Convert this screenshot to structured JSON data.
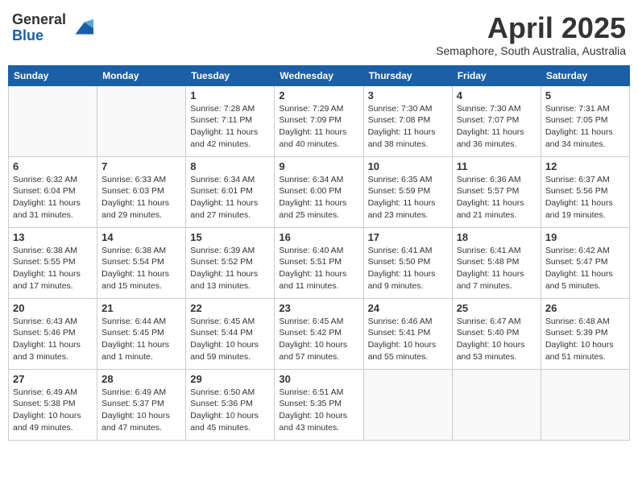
{
  "header": {
    "logo": {
      "general": "General",
      "blue": "Blue"
    },
    "title": "April 2025",
    "subtitle": "Semaphore, South Australia, Australia"
  },
  "calendar": {
    "days_of_week": [
      "Sunday",
      "Monday",
      "Tuesday",
      "Wednesday",
      "Thursday",
      "Friday",
      "Saturday"
    ],
    "weeks": [
      [
        {
          "day": "",
          "info": ""
        },
        {
          "day": "",
          "info": ""
        },
        {
          "day": "1",
          "info": "Sunrise: 7:28 AM\nSunset: 7:11 PM\nDaylight: 11 hours\nand 42 minutes."
        },
        {
          "day": "2",
          "info": "Sunrise: 7:29 AM\nSunset: 7:09 PM\nDaylight: 11 hours\nand 40 minutes."
        },
        {
          "day": "3",
          "info": "Sunrise: 7:30 AM\nSunset: 7:08 PM\nDaylight: 11 hours\nand 38 minutes."
        },
        {
          "day": "4",
          "info": "Sunrise: 7:30 AM\nSunset: 7:07 PM\nDaylight: 11 hours\nand 36 minutes."
        },
        {
          "day": "5",
          "info": "Sunrise: 7:31 AM\nSunset: 7:05 PM\nDaylight: 11 hours\nand 34 minutes."
        }
      ],
      [
        {
          "day": "6",
          "info": "Sunrise: 6:32 AM\nSunset: 6:04 PM\nDaylight: 11 hours\nand 31 minutes."
        },
        {
          "day": "7",
          "info": "Sunrise: 6:33 AM\nSunset: 6:03 PM\nDaylight: 11 hours\nand 29 minutes."
        },
        {
          "day": "8",
          "info": "Sunrise: 6:34 AM\nSunset: 6:01 PM\nDaylight: 11 hours\nand 27 minutes."
        },
        {
          "day": "9",
          "info": "Sunrise: 6:34 AM\nSunset: 6:00 PM\nDaylight: 11 hours\nand 25 minutes."
        },
        {
          "day": "10",
          "info": "Sunrise: 6:35 AM\nSunset: 5:59 PM\nDaylight: 11 hours\nand 23 minutes."
        },
        {
          "day": "11",
          "info": "Sunrise: 6:36 AM\nSunset: 5:57 PM\nDaylight: 11 hours\nand 21 minutes."
        },
        {
          "day": "12",
          "info": "Sunrise: 6:37 AM\nSunset: 5:56 PM\nDaylight: 11 hours\nand 19 minutes."
        }
      ],
      [
        {
          "day": "13",
          "info": "Sunrise: 6:38 AM\nSunset: 5:55 PM\nDaylight: 11 hours\nand 17 minutes."
        },
        {
          "day": "14",
          "info": "Sunrise: 6:38 AM\nSunset: 5:54 PM\nDaylight: 11 hours\nand 15 minutes."
        },
        {
          "day": "15",
          "info": "Sunrise: 6:39 AM\nSunset: 5:52 PM\nDaylight: 11 hours\nand 13 minutes."
        },
        {
          "day": "16",
          "info": "Sunrise: 6:40 AM\nSunset: 5:51 PM\nDaylight: 11 hours\nand 11 minutes."
        },
        {
          "day": "17",
          "info": "Sunrise: 6:41 AM\nSunset: 5:50 PM\nDaylight: 11 hours\nand 9 minutes."
        },
        {
          "day": "18",
          "info": "Sunrise: 6:41 AM\nSunset: 5:48 PM\nDaylight: 11 hours\nand 7 minutes."
        },
        {
          "day": "19",
          "info": "Sunrise: 6:42 AM\nSunset: 5:47 PM\nDaylight: 11 hours\nand 5 minutes."
        }
      ],
      [
        {
          "day": "20",
          "info": "Sunrise: 6:43 AM\nSunset: 5:46 PM\nDaylight: 11 hours\nand 3 minutes."
        },
        {
          "day": "21",
          "info": "Sunrise: 6:44 AM\nSunset: 5:45 PM\nDaylight: 11 hours\nand 1 minute."
        },
        {
          "day": "22",
          "info": "Sunrise: 6:45 AM\nSunset: 5:44 PM\nDaylight: 10 hours\nand 59 minutes."
        },
        {
          "day": "23",
          "info": "Sunrise: 6:45 AM\nSunset: 5:42 PM\nDaylight: 10 hours\nand 57 minutes."
        },
        {
          "day": "24",
          "info": "Sunrise: 6:46 AM\nSunset: 5:41 PM\nDaylight: 10 hours\nand 55 minutes."
        },
        {
          "day": "25",
          "info": "Sunrise: 6:47 AM\nSunset: 5:40 PM\nDaylight: 10 hours\nand 53 minutes."
        },
        {
          "day": "26",
          "info": "Sunrise: 6:48 AM\nSunset: 5:39 PM\nDaylight: 10 hours\nand 51 minutes."
        }
      ],
      [
        {
          "day": "27",
          "info": "Sunrise: 6:49 AM\nSunset: 5:38 PM\nDaylight: 10 hours\nand 49 minutes."
        },
        {
          "day": "28",
          "info": "Sunrise: 6:49 AM\nSunset: 5:37 PM\nDaylight: 10 hours\nand 47 minutes."
        },
        {
          "day": "29",
          "info": "Sunrise: 6:50 AM\nSunset: 5:36 PM\nDaylight: 10 hours\nand 45 minutes."
        },
        {
          "day": "30",
          "info": "Sunrise: 6:51 AM\nSunset: 5:35 PM\nDaylight: 10 hours\nand 43 minutes."
        },
        {
          "day": "",
          "info": ""
        },
        {
          "day": "",
          "info": ""
        },
        {
          "day": "",
          "info": ""
        }
      ]
    ]
  }
}
